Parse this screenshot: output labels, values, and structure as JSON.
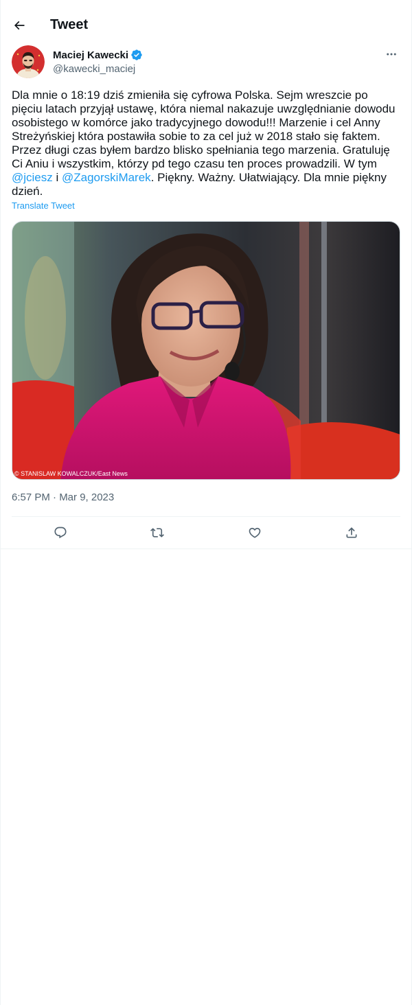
{
  "header": {
    "title": "Tweet",
    "back_icon": "arrow-left-icon"
  },
  "author": {
    "name": "Maciej Kawecki",
    "handle": "@kawecki_maciej",
    "verified": true,
    "verified_color": "#1d9bf0"
  },
  "tweet": {
    "text_part1": "Dla mnie o 18:19 dziś zmieniła się cyfrowa Polska. Sejm wreszcie po pięciu latach przyjął ustawę, która niemal nakazuje uwzględnianie dowodu osobistego w komórce jako tradycyjnego dowodu!!! Marzenie i cel Anny Streżyńskiej która postawiła sobie to za cel już w 2018 stało się faktem. Przez długi czas byłem bardzo blisko spełniania tego marzenia. Gratuluję Ci Aniu i wszystkim, którzy pd tego czasu ten proces prowadzili. W tym ",
    "mention1": "@jciesz",
    "text_part2": " i ",
    "mention2": "@ZagorskiMarek",
    "text_part3": ". Piękny. Ważny. Ułatwiający. Dla mnie piękny dzień.",
    "translate_label": "Translate Tweet",
    "media_credit": "© STANISLAW KOWALCZUK/East News",
    "timestamp": "6:57 PM · Mar 9, 2023"
  },
  "actions": [
    {
      "icon": "reply-icon"
    },
    {
      "icon": "retweet-icon"
    },
    {
      "icon": "like-icon"
    },
    {
      "icon": "share-icon"
    }
  ],
  "colors": {
    "accent": "#1d9bf0",
    "text": "#0f1419",
    "secondary": "#536471",
    "border": "#eff3f4"
  }
}
